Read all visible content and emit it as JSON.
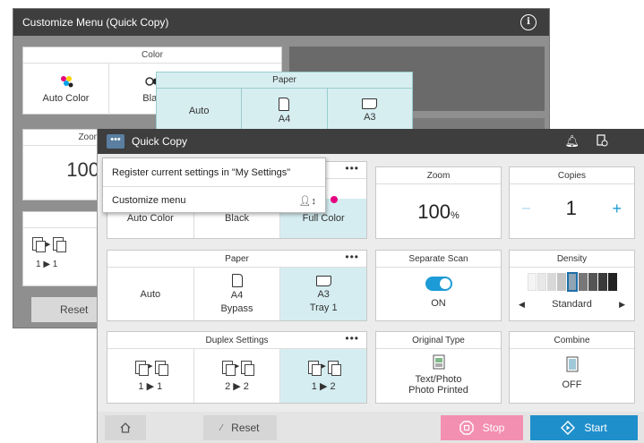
{
  "back_window": {
    "title": "Customize Menu (Quick Copy)",
    "info_label": "i",
    "color_panel": {
      "header": "Color",
      "options": [
        "Auto Color",
        "Blac"
      ]
    },
    "paper_popup": {
      "header": "Paper",
      "options": [
        "Auto",
        "A4",
        "A3"
      ]
    },
    "zoom_panel": {
      "header": "Zoom",
      "value": "100"
    },
    "duplex_panel": {
      "value": "1 ▶ 1"
    },
    "reset_label": "Reset"
  },
  "front_window": {
    "title": "Quick Copy",
    "menu_button": "•••",
    "popup_menu": {
      "items": [
        "Register current settings in \"My Settings\"",
        "Customize menu"
      ]
    },
    "color_card": {
      "more": "•••",
      "options": [
        "Auto Color",
        "Black",
        "Full Color"
      ],
      "selected": "Full Color"
    },
    "paper_card": {
      "header": "Paper",
      "more": "•••",
      "options": [
        {
          "line1": "Auto",
          "line2": ""
        },
        {
          "line1": "A4",
          "line2": "Bypass"
        },
        {
          "line1": "A3",
          "line2": "Tray 1"
        }
      ]
    },
    "duplex_card": {
      "header": "Duplex Settings",
      "more": "•••",
      "options": [
        "1 ▶ 1",
        "2 ▶ 2",
        "1 ▶ 2"
      ]
    },
    "zoom_card": {
      "header": "Zoom",
      "value": "100",
      "unit": "%"
    },
    "copies_card": {
      "header": "Copies",
      "value": "1",
      "minus": "–",
      "plus": "+"
    },
    "separate_scan_card": {
      "header": "Separate Scan",
      "value": "ON"
    },
    "density_card": {
      "header": "Density",
      "value": "Standard",
      "left": "◀",
      "right": "▶"
    },
    "original_type_card": {
      "header": "Original Type",
      "line1": "Text/Photo",
      "line2": "Photo Printed"
    },
    "combine_card": {
      "header": "Combine",
      "value": "OFF"
    },
    "bottom": {
      "reset_label": "Reset",
      "stop_label": "Stop",
      "start_label": "Start"
    },
    "colors": {
      "accent_blue": "#1d9bd6",
      "start_button": "#1f8fcb",
      "stop_button": "#f38fb0",
      "selected_bg": "#d5edf1",
      "title_bar": "#3e3e3e"
    }
  }
}
